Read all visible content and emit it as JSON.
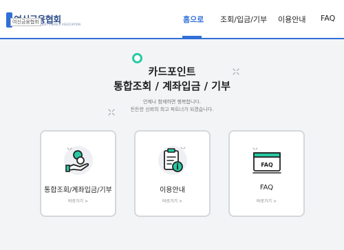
{
  "header": {
    "logo_text": "여신금융협회",
    "logo_badge": "여신금융협회",
    "logo_sub": "CREDIT FINANCE ASSOCIATION",
    "nav": [
      {
        "label": "홈으로",
        "active": true
      },
      {
        "label": "조회/입금/기부",
        "active": false
      },
      {
        "label": "이용안내",
        "active": false
      },
      {
        "label": "FAQ",
        "active": false
      }
    ]
  },
  "hero": {
    "title_line1": "카드포인트",
    "title_line2": "통합조회 / 계좌입금 / 기부",
    "sub_line1": "언제나 함께하면 행복합니다.",
    "sub_line2": "든든한 신뢰의 최고 파트너가 되겠습니다."
  },
  "cards": [
    {
      "title": "통합조회/계좌입금/기부",
      "link": "바로가기 >",
      "icon": "hand-coin-icon"
    },
    {
      "title": "이용안내",
      "link": "바로가기 >",
      "icon": "clipboard-info-icon"
    },
    {
      "title": "FAQ",
      "link": "바로가기 >",
      "icon": "faq-window-icon"
    }
  ],
  "colors": {
    "accent": "#2f6fd8",
    "teal": "#27c9a2",
    "background": "#f3f4f6"
  }
}
